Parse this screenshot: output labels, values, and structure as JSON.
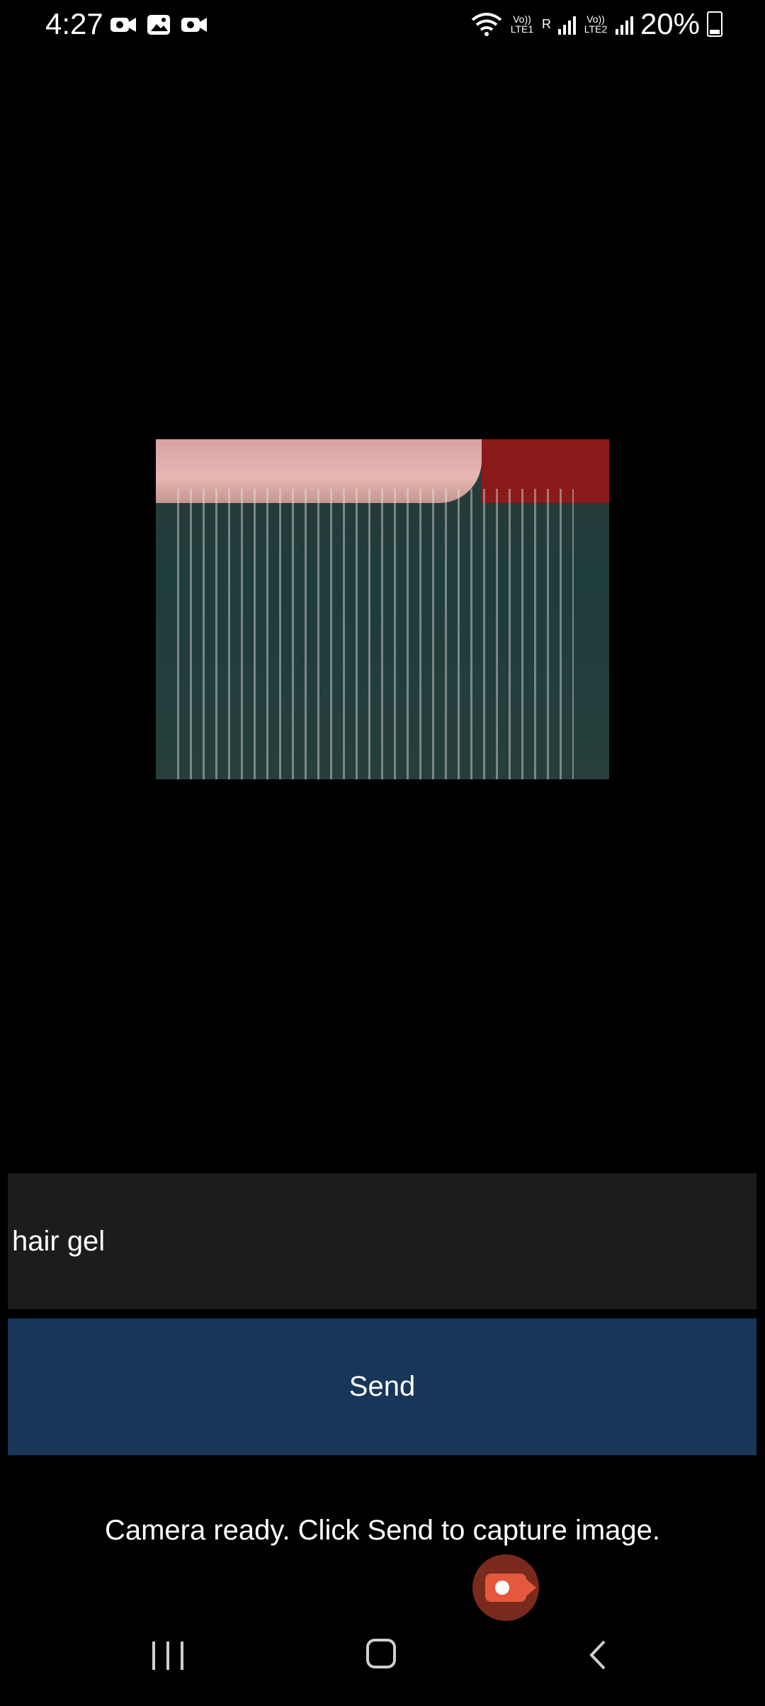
{
  "status_bar": {
    "time": "4:27",
    "left_icons": [
      "video-camera-icon",
      "gallery-icon",
      "video-camera-icon"
    ],
    "wifi": "wifi-icon",
    "sim1_label": "Vo)) LTE1",
    "sim1_roaming": "R",
    "sim2_label": "Vo)) LTE2",
    "battery_percent": "20%"
  },
  "preview": {
    "description_icon": "camera-preview"
  },
  "input": {
    "value": "hair gel",
    "placeholder": ""
  },
  "send_button": {
    "label": "Send",
    "color": "#17365a"
  },
  "status_message": "Camera ready. Click Send to capture image.",
  "nav": {
    "recents": "recents-icon",
    "home": "home-icon",
    "back": "back-icon"
  }
}
